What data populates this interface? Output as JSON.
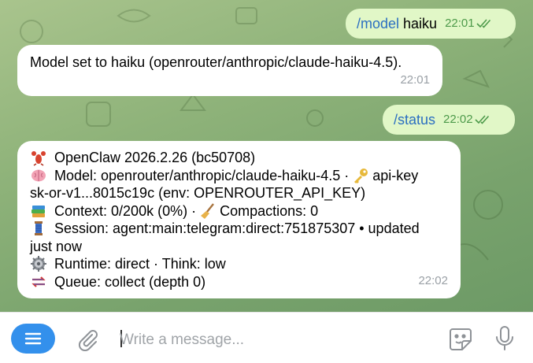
{
  "messages": [
    {
      "direction": "out",
      "command": "/model",
      "argument": "haiku",
      "time": "22:01"
    },
    {
      "direction": "in",
      "text": "Model set to haiku (openrouter/anthropic/claude-haiku-4.5).",
      "time": "22:01"
    },
    {
      "direction": "out",
      "command": "/status",
      "time": "22:02"
    },
    {
      "direction": "in",
      "time": "22:02",
      "lines": [
        "OpenClaw 2026.2.26 (bc50708)",
        "Model: openrouter/anthropic/claude-haiku-4.5 ·",
        "api-key",
        "sk-or-v1...8015c19c (env: OPENROUTER_API_KEY)",
        "Context: 0/200k (0%) ·",
        "Compactions: 0",
        "Session: agent:main:telegram:direct:751875307 • updated",
        "just now",
        "Runtime: direct · Think: low",
        "Queue: collect (depth 0)"
      ],
      "emoji": [
        "lobster-emoji",
        "brain-emoji",
        "key-emoji",
        "books-emoji",
        "broom-emoji",
        "thread-emoji",
        "gear-emoji",
        "queue-arrows-emoji"
      ]
    }
  ],
  "composer": {
    "placeholder": "Write a message..."
  },
  "colors": {
    "accent": "#3390ec",
    "outgoing_bubble": "#e1f7c7",
    "incoming_bubble": "#ffffff",
    "command_link": "#2b6fc1",
    "read_check": "#4d9a4a",
    "time_in": "#9aa0a6"
  },
  "icons": [
    "menu-icon",
    "paperclip-icon",
    "sticker-icon",
    "microphone-icon",
    "double-check-icon"
  ]
}
